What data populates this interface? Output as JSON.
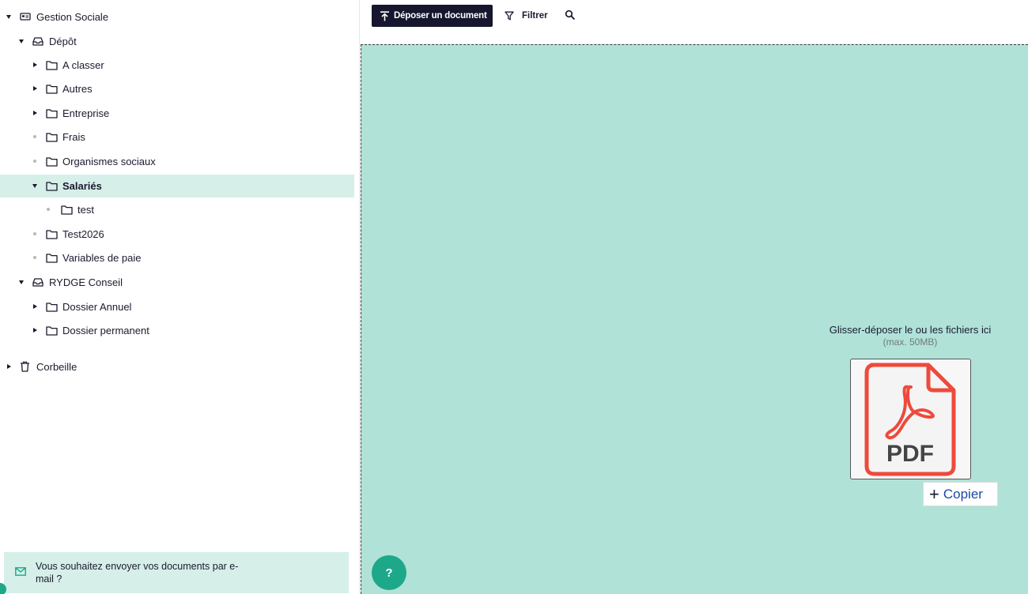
{
  "tree": {
    "root": {
      "label": "Gestion Sociale",
      "icon": "id-card-icon",
      "expanded": true
    },
    "depot": {
      "label": "Dépôt",
      "icon": "inbox-tray-icon",
      "expanded": true
    },
    "depot_children": [
      {
        "label": "A classer",
        "icon": "folder-icon",
        "toggle": "closed"
      },
      {
        "label": "Autres",
        "icon": "folder-icon",
        "toggle": "closed"
      },
      {
        "label": "Entreprise",
        "icon": "folder-icon",
        "toggle": "closed"
      },
      {
        "label": "Frais",
        "icon": "folder-icon",
        "toggle": "dot"
      },
      {
        "label": "Organismes sociaux",
        "icon": "folder-icon",
        "toggle": "dot"
      },
      {
        "label": "Salariés",
        "icon": "folder-icon",
        "toggle": "open",
        "selected": true
      },
      {
        "label": "test",
        "icon": "folder-icon",
        "toggle": "dot"
      },
      {
        "label": "Test2026",
        "icon": "folder-icon",
        "toggle": "dot"
      },
      {
        "label": "Variables de paie",
        "icon": "folder-icon",
        "toggle": "dot"
      }
    ],
    "rydge": {
      "label": "RYDGE Conseil",
      "icon": "inbox-tray-icon",
      "expanded": true
    },
    "rydge_children": [
      {
        "label": "Dossier Annuel",
        "icon": "folder-icon",
        "toggle": "closed"
      },
      {
        "label": "Dossier permanent",
        "icon": "folder-icon",
        "toggle": "closed"
      }
    ],
    "trash": {
      "label": "Corbeille",
      "icon": "trash-icon",
      "toggle": "closed"
    }
  },
  "email_banner": {
    "text": "Vous souhaitez envoyer vos documents par e-mail ?",
    "icon": "mail-icon"
  },
  "toolbar": {
    "upload_label": "Déposer un document",
    "filter_label": "Filtrer",
    "search_icon": "search-icon"
  },
  "dropzone": {
    "instruction": "Glisser-déposer le ou les fichiers ici",
    "limit": "(max. 50MB)",
    "file_type": "PDF",
    "copy_label": "Copier"
  },
  "help": {
    "label": "?"
  },
  "colors": {
    "accent": "#1da88a",
    "selected_bg": "#d6efe9",
    "dropzone_bg": "#b0e2d8",
    "primary_button": "#16162e",
    "pdf_red": "#ee4a3c",
    "copy_link": "#1b4aa8"
  }
}
